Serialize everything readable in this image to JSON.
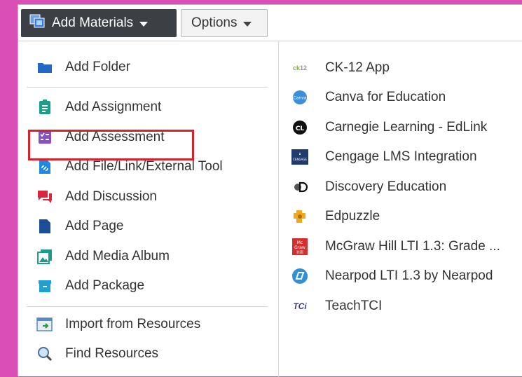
{
  "toolbar": {
    "add_materials_label": "Add Materials",
    "options_label": "Options"
  },
  "menu": {
    "left_items": [
      {
        "label": "Add Folder",
        "icon": "folder-icon"
      },
      {
        "label": "Add Assignment",
        "icon": "assignment-icon"
      },
      {
        "label": "Add Assessment",
        "icon": "assessment-icon"
      },
      {
        "label": "Add File/Link/External Tool",
        "icon": "file-link-icon"
      },
      {
        "label": "Add Discussion",
        "icon": "discussion-icon"
      },
      {
        "label": "Add Page",
        "icon": "page-icon"
      },
      {
        "label": "Add Media Album",
        "icon": "media-album-icon"
      },
      {
        "label": "Add Package",
        "icon": "package-icon"
      },
      {
        "label": "Import from Resources",
        "icon": "import-icon"
      },
      {
        "label": "Find Resources",
        "icon": "search-icon"
      }
    ],
    "right_items": [
      {
        "label": "CK-12 App",
        "icon_text": "ck12"
      },
      {
        "label": "Canva for Education",
        "icon_text": "Canva"
      },
      {
        "label": "Carnegie Learning - EdLink",
        "icon_text": "CL"
      },
      {
        "label": "Cengage LMS Integration",
        "icon_text": "CENGAGE"
      },
      {
        "label": "Discovery Education",
        "icon_text": "D"
      },
      {
        "label": "Edpuzzle",
        "icon_text": ""
      },
      {
        "label": "McGraw Hill LTI 1.3: Grade ...",
        "icon_text": "Mc Graw Hill"
      },
      {
        "label": "Nearpod LTI 1.3 by Nearpod",
        "icon_text": ""
      },
      {
        "label": "TeachTCI",
        "icon_text": "TCi"
      }
    ]
  },
  "colors": {
    "background": "#d94fb5",
    "highlight": "#d6222b",
    "dark_button": "#3c3f44"
  }
}
